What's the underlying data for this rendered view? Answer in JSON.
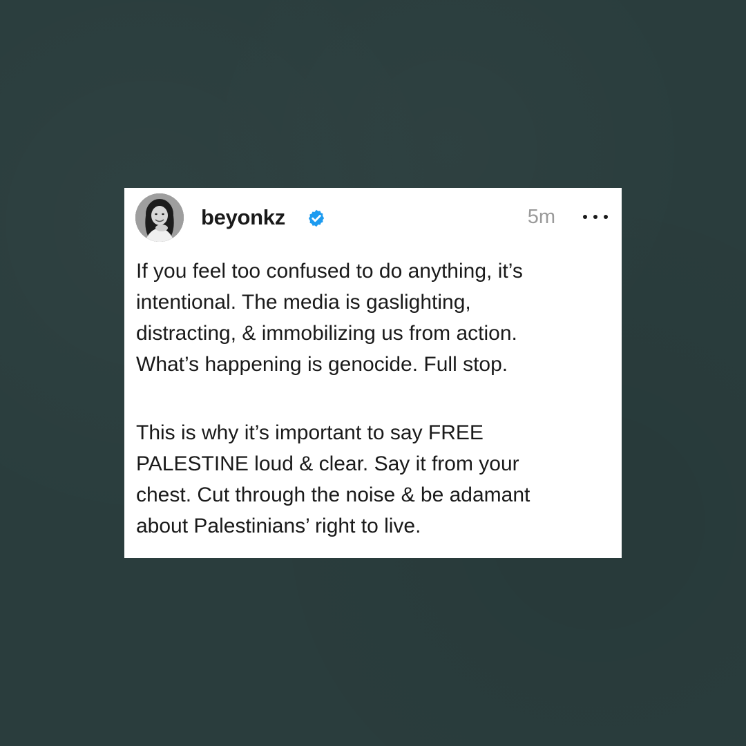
{
  "post": {
    "username": "beyonkz",
    "verified": true,
    "timestamp": "5m",
    "more_icon": "more-horizontal-icon",
    "verified_icon": "verified-badge-icon",
    "paragraphs": [
      "If you feel too confused to do anything, it’s\nintentional. The media is gaslighting,\ndistracting, & immobilizing us from action.\nWhat’s happening is genocide. Full stop.",
      "This is why it’s important to say FREE\nPALESTINE loud & clear. Say it from your\nchest. Cut through the noise & be adamant\nabout Palestinians’ right to live."
    ]
  },
  "colors": {
    "background": "#2a3d3d",
    "card": "#ffffff",
    "verified": "#1d9bf0",
    "timestamp": "#9a9a9a",
    "text": "#1a1a1a"
  }
}
